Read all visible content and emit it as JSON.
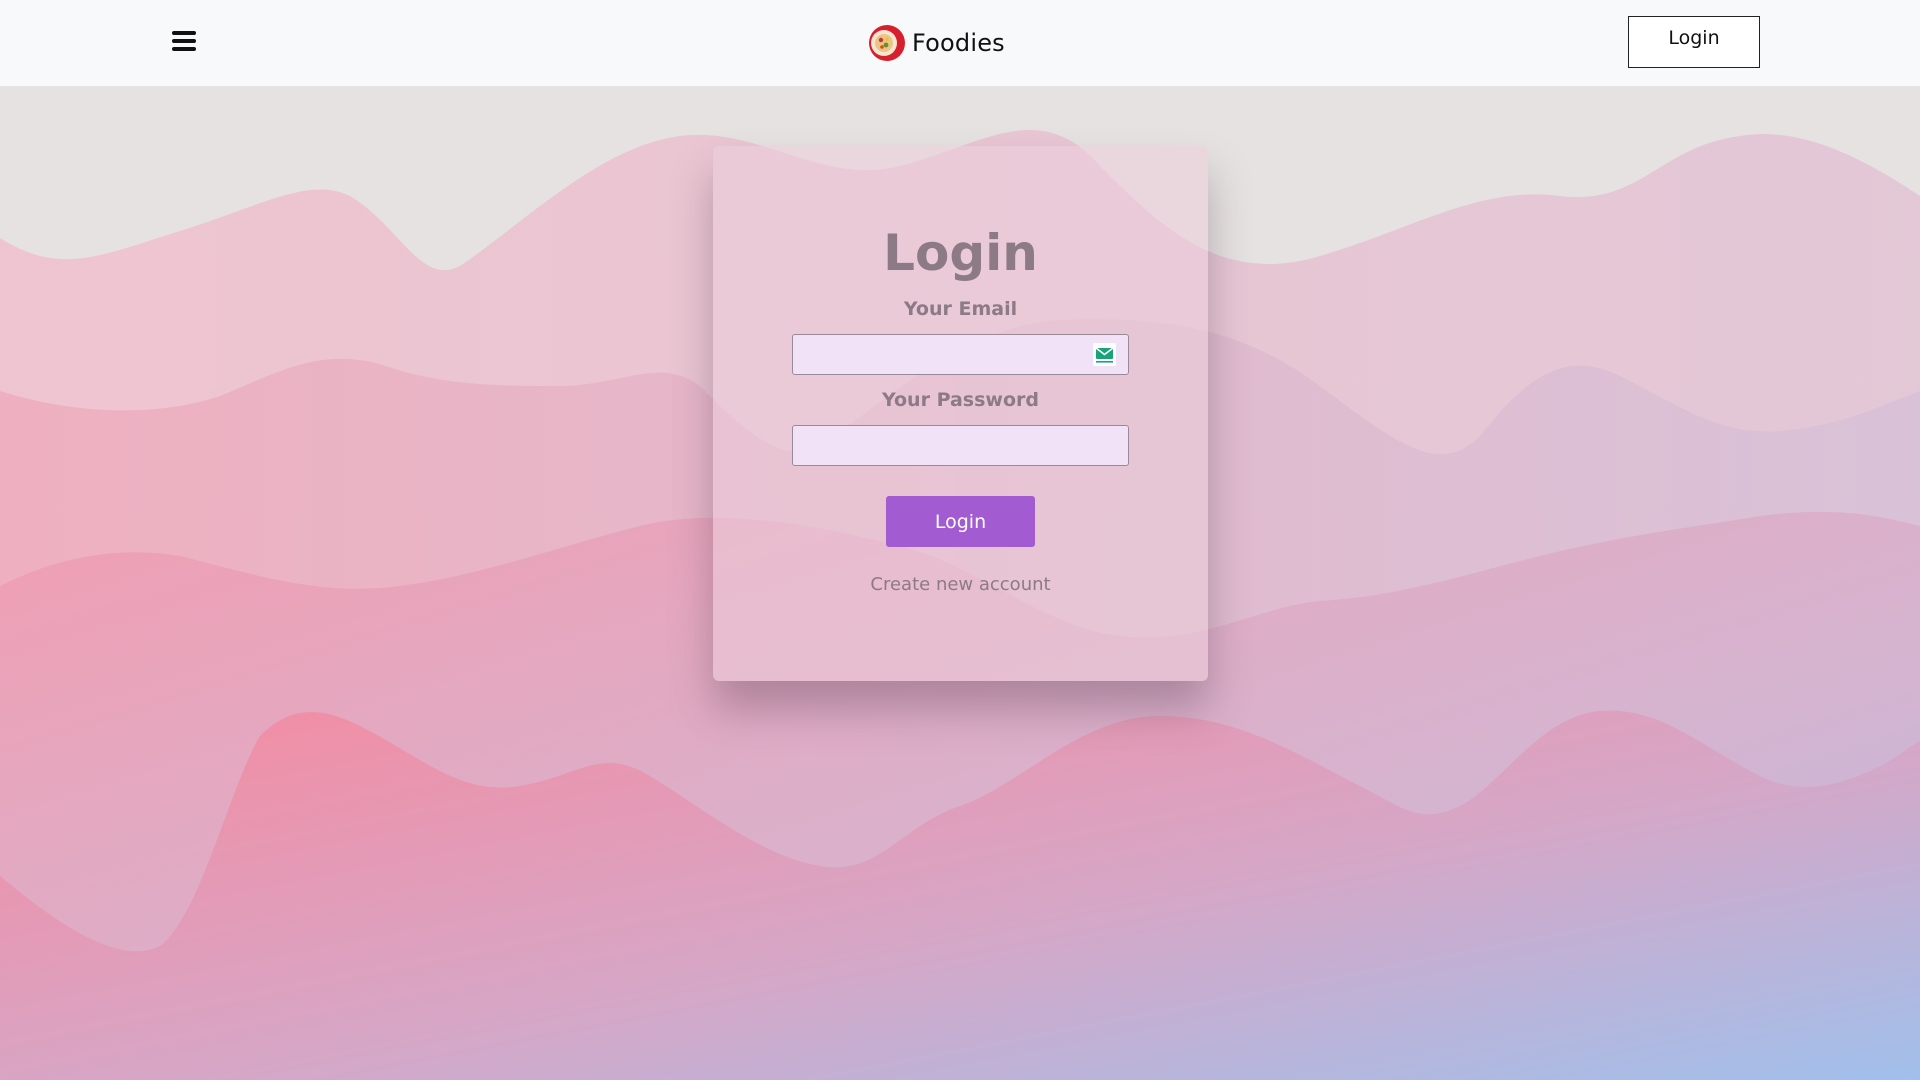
{
  "navbar": {
    "menu_icon": "hamburger-icon",
    "brand_logo_icon": "food-bowl-logo-icon",
    "brand_name": "Foodies",
    "login_button": "Login"
  },
  "login_form": {
    "title": "Login",
    "email_label": "Your Email",
    "email_value": "",
    "email_icon": "email-extension-icon",
    "password_label": "Your Password",
    "password_value": "",
    "submit_label": "Login",
    "create_account_link": "Create new account"
  },
  "colors": {
    "primary_button": "#a25bd0",
    "input_background": "#f1e2f8",
    "card_text": "#8c7a86",
    "navbar_background": "#f8f9fa"
  }
}
